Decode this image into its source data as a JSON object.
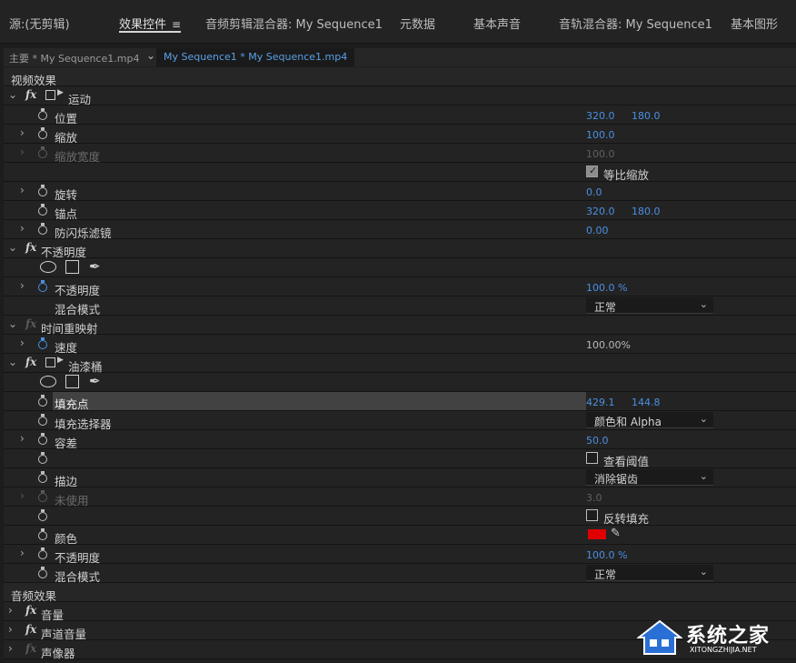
{
  "tabs": [
    {
      "label": "源:(无剪辑)",
      "active": false
    },
    {
      "label": "效果控件",
      "active": true
    },
    {
      "label": "音频剪辑混合器: My Sequence1",
      "active": false
    },
    {
      "label": "元数据",
      "active": false
    },
    {
      "label": "基本声音",
      "active": false
    },
    {
      "label": "音轨混合器: My Sequence1",
      "active": false
    },
    {
      "label": "基本图形",
      "active": false
    }
  ],
  "tab_menu_icon": "hamburger-icon",
  "clip": {
    "master": "主要 * My Sequence1.mp4",
    "active": "My Sequence1 * My Sequence1.mp4"
  },
  "sections": {
    "video_effects": "视频效果",
    "audio_effects": "音频效果"
  },
  "motion": {
    "label": "运动",
    "position": {
      "label": "位置",
      "x": "320.0",
      "y": "180.0"
    },
    "scale": {
      "label": "缩放",
      "value": "100.0"
    },
    "scale_width": {
      "label": "缩放宽度",
      "value": "100.0"
    },
    "uniform_scale": {
      "label": "等比缩放",
      "checked": true
    },
    "rotation": {
      "label": "旋转",
      "value": "0.0"
    },
    "anchor": {
      "label": "锚点",
      "x": "320.0",
      "y": "180.0"
    },
    "anti_flicker": {
      "label": "防闪烁滤镜",
      "value": "0.00"
    }
  },
  "opacity": {
    "label": "不透明度",
    "opacity": {
      "label": "不透明度",
      "value": "100.0 %"
    },
    "blend_mode": {
      "label": "混合模式",
      "value": "正常"
    }
  },
  "time_remap": {
    "label": "时间重映射",
    "speed": {
      "label": "速度",
      "value": "100.00%"
    }
  },
  "paint_bucket": {
    "label": "油漆桶",
    "fill_point": {
      "label": "填充点",
      "x": "429.1",
      "y": "144.8"
    },
    "fill_selector": {
      "label": "填充选择器",
      "value": "颜色和 Alpha"
    },
    "tolerance": {
      "label": "容差",
      "value": "50.0"
    },
    "view_threshold": {
      "label": "查看阈值",
      "checked": false
    },
    "stroke": {
      "label": "描边",
      "value": "消除锯齿"
    },
    "unused": {
      "label": "未使用",
      "value": "3.0"
    },
    "invert_fill": {
      "label": "反转填充",
      "checked": false
    },
    "color": {
      "label": "颜色",
      "value": "#e00000"
    },
    "opacity": {
      "label": "不透明度",
      "value": "100.0 %"
    },
    "blend_mode": {
      "label": "混合模式",
      "value": "正常"
    }
  },
  "audio": {
    "volume": "音量",
    "channel_volume": "声道音量",
    "panner": "声像器"
  },
  "watermark": {
    "title": "系统之家",
    "url": "XITONGZHIJIA.NET"
  },
  "colors": {
    "accent_blue": "#4a90e2",
    "panel_bg": "#232323",
    "swatch_red": "#e00000"
  }
}
